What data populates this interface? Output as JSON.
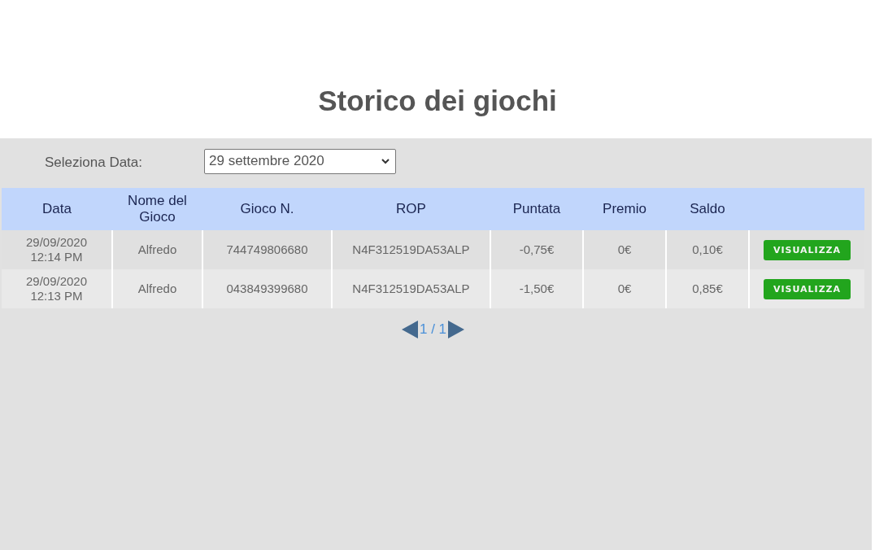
{
  "title": "Storico dei giochi",
  "filter": {
    "label": "Seleziona Data:",
    "value": "29 settembre 2020"
  },
  "table": {
    "columns": [
      "Data",
      "Nome del Gioco",
      "Gioco N.",
      "ROP",
      "Puntata",
      "Premio",
      "Saldo"
    ],
    "rows": [
      {
        "date": "29/09/2020",
        "time": "12:14 PM",
        "game": "Alfredo",
        "number": "744749806680",
        "rop": "N4F312519DA53ALP",
        "bet": "-0,75€",
        "prize": "0€",
        "balance": "0,10€",
        "action": "VISUALIZZA"
      },
      {
        "date": "29/09/2020",
        "time": "12:13 PM",
        "game": "Alfredo",
        "number": "043849399680",
        "rop": "N4F312519DA53ALP",
        "bet": "-1,50€",
        "prize": "0€",
        "balance": "0,85€",
        "action": "VISUALIZZA"
      }
    ]
  },
  "pagination": {
    "label": "1 / 1"
  }
}
